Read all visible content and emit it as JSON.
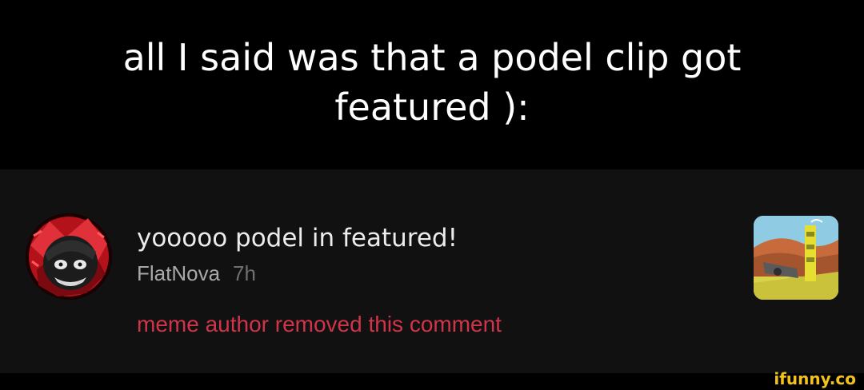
{
  "caption": {
    "text": "all I said was that a podel clip got featured ):"
  },
  "comment": {
    "text": "yooooo podel in featured!",
    "author": "FlatNova",
    "age": "7h",
    "removed_notice": "meme author removed this comment",
    "removed_color": "#d1344a"
  },
  "watermark": {
    "text": "ifunny.co",
    "color": "#f3c21a"
  }
}
